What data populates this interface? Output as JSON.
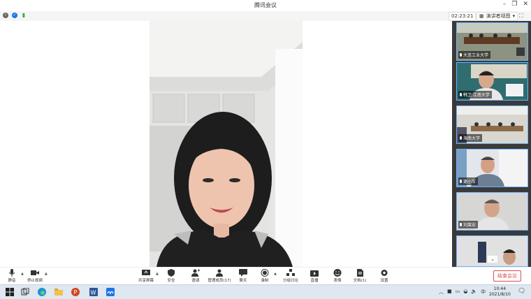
{
  "window": {
    "title": "腾讯会议"
  },
  "status": {
    "timer": "02:23:21",
    "view_label": "演讲者视图"
  },
  "participants": [
    {
      "name": "大连工业大学"
    },
    {
      "name": "韩卫 江南大学"
    },
    {
      "name": "海南大学"
    },
    {
      "name": "谢小军"
    },
    {
      "name": "刘莱宏"
    },
    {
      "name": ""
    }
  ],
  "toolbar": {
    "mute": "静音",
    "stop_video": "停止视频",
    "share_screen": "共享屏幕",
    "security": "安全",
    "invite": "邀请",
    "manage_members": "管理成员(17)",
    "chat": "聊天",
    "record": "录制",
    "breakout": "分组讨论",
    "live": "直播",
    "reactions": "表情",
    "docs": "文档(1)",
    "settings": "设置",
    "end_meeting": "结束会议"
  },
  "taskbar": {
    "time": "10:44",
    "date": "2021/8/10",
    "ime": "中"
  },
  "colors": {
    "accent": "#1a73e8",
    "end": "#e04b4b",
    "sidebar": "#3a3a3a"
  }
}
